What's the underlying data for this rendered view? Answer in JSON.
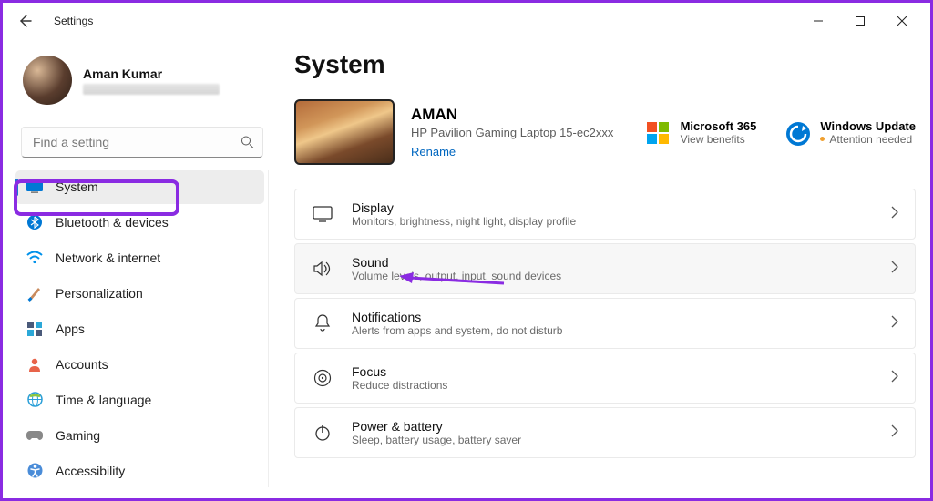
{
  "window": {
    "title": "Settings"
  },
  "profile": {
    "name": "Aman Kumar"
  },
  "search": {
    "placeholder": "Find a setting"
  },
  "nav": {
    "items": [
      {
        "label": "System",
        "icon": "system"
      },
      {
        "label": "Bluetooth & devices",
        "icon": "bluetooth"
      },
      {
        "label": "Network & internet",
        "icon": "wifi"
      },
      {
        "label": "Personalization",
        "icon": "brush"
      },
      {
        "label": "Apps",
        "icon": "apps"
      },
      {
        "label": "Accounts",
        "icon": "person"
      },
      {
        "label": "Time & language",
        "icon": "globe"
      },
      {
        "label": "Gaming",
        "icon": "game"
      },
      {
        "label": "Accessibility",
        "icon": "access"
      }
    ]
  },
  "page": {
    "title": "System"
  },
  "device": {
    "name": "AMAN",
    "model": "HP Pavilion Gaming Laptop 15-ec2xxx",
    "rename": "Rename"
  },
  "promos": {
    "m365": {
      "title": "Microsoft 365",
      "sub": "View benefits"
    },
    "update": {
      "title": "Windows Update",
      "sub": "Attention needed"
    }
  },
  "cards": [
    {
      "title": "Display",
      "sub": "Monitors, brightness, night light, display profile",
      "icon": "display"
    },
    {
      "title": "Sound",
      "sub": "Volume levels, output, input, sound devices",
      "icon": "sound"
    },
    {
      "title": "Notifications",
      "sub": "Alerts from apps and system, do not disturb",
      "icon": "bell"
    },
    {
      "title": "Focus",
      "sub": "Reduce distractions",
      "icon": "focus"
    },
    {
      "title": "Power & battery",
      "sub": "Sleep, battery usage, battery saver",
      "icon": "power"
    }
  ]
}
